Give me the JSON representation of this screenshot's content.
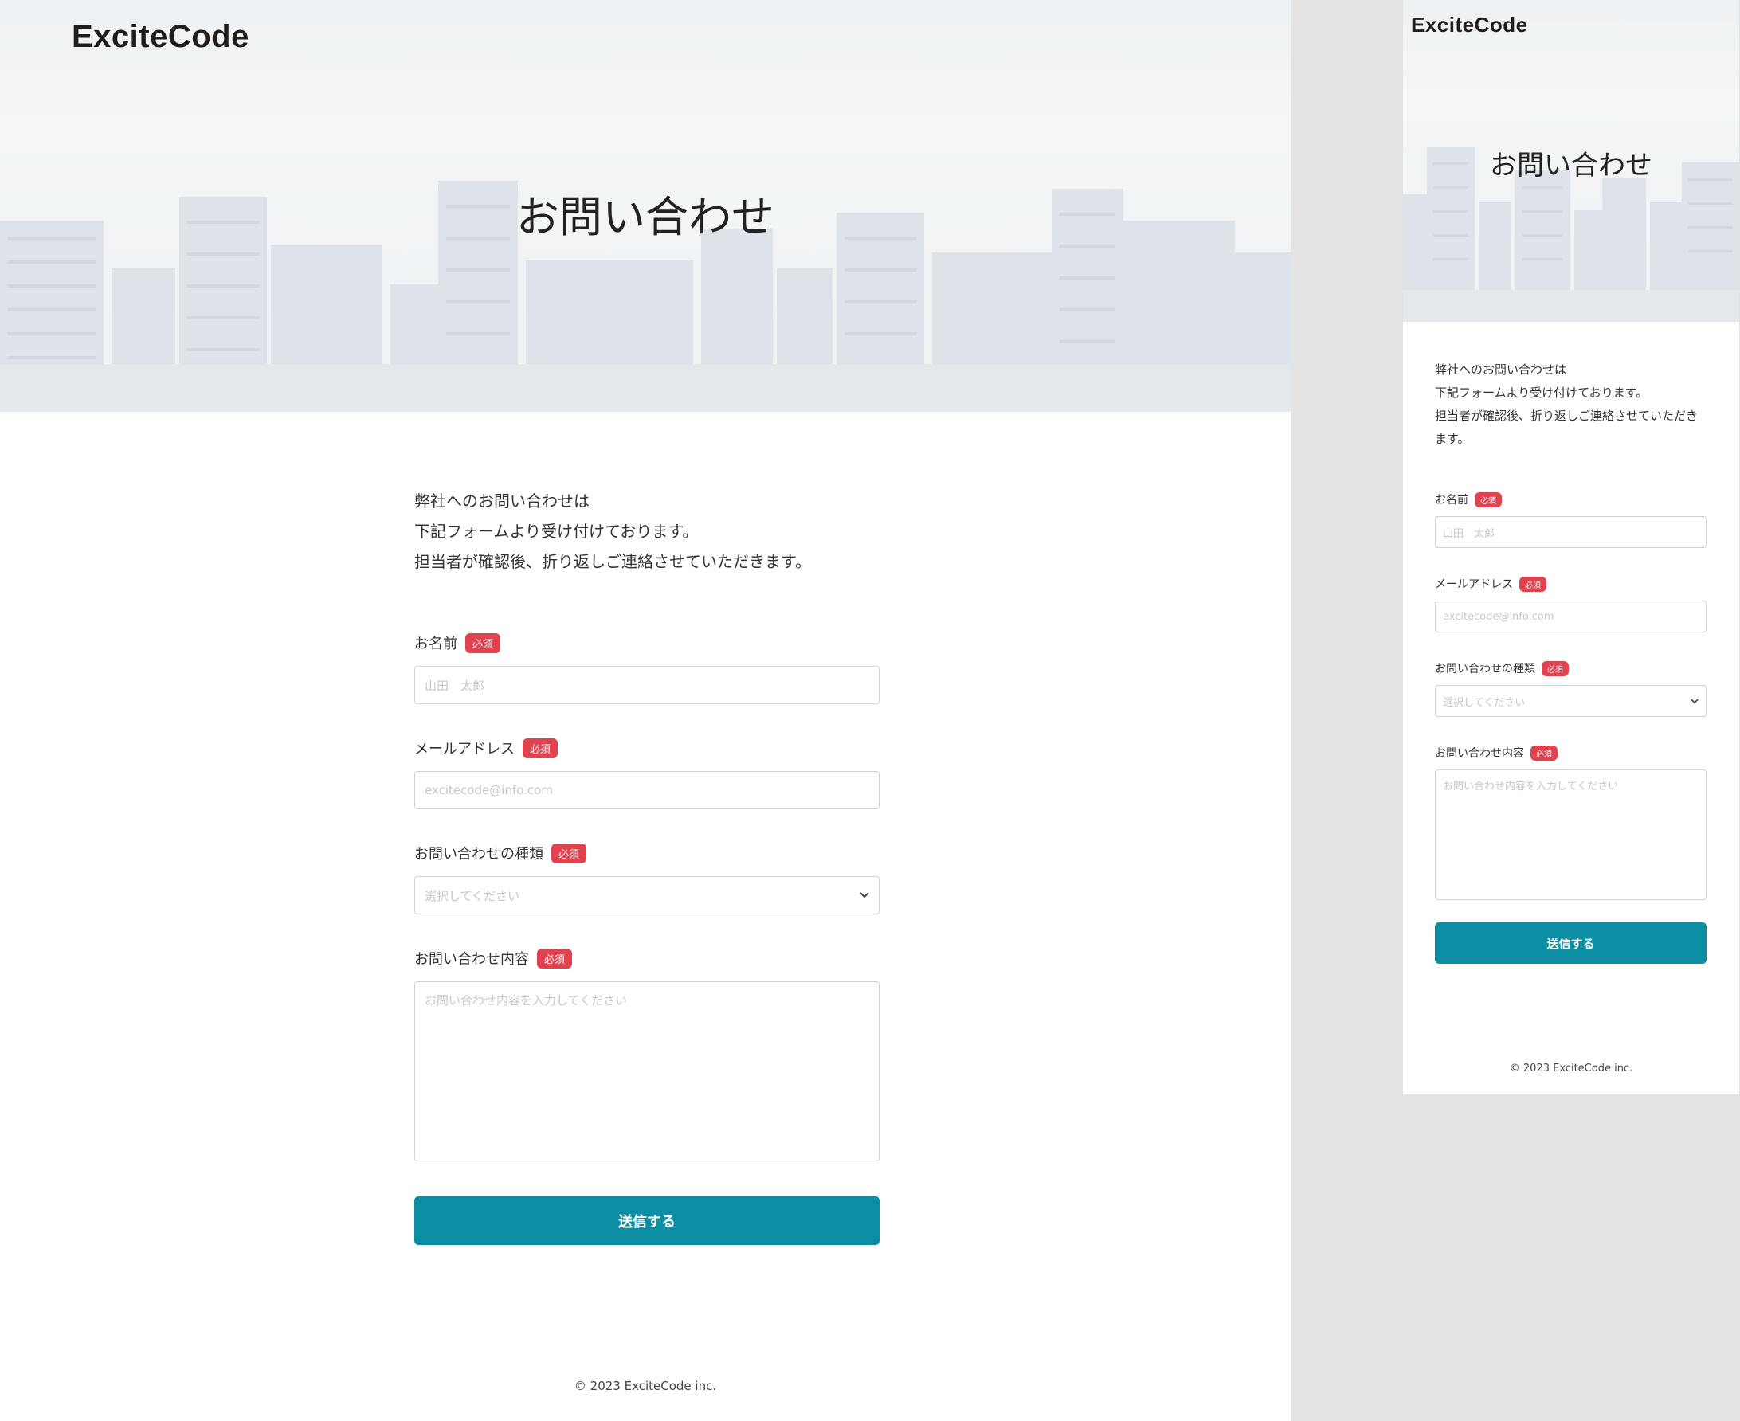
{
  "brand": "ExciteCode",
  "page_title": "お問い合わせ",
  "intro": {
    "line1": "弊社へのお問い合わせは",
    "line2": "下記フォームより受け付けております。",
    "line3": "担当者が確認後、折り返しご連絡させていただきます。",
    "line3_mobile": "担当者が確認後、折り返しご連絡させていただきます。"
  },
  "form": {
    "required_badge": "必須",
    "name": {
      "label": "お名前",
      "placeholder": "山田　太郎"
    },
    "email": {
      "label": "メールアドレス",
      "placeholder": "excitecode@info.com"
    },
    "type": {
      "label": "お問い合わせの種類",
      "placeholder": "選択してください"
    },
    "message": {
      "label": "お問い合わせ内容",
      "placeholder": "お問い合わせ内容を入力してください"
    },
    "submit_label": "送信する"
  },
  "footer": {
    "copyright": "© 2023 ExciteCode inc."
  },
  "icons": {
    "select_arrow": "chevron-down-icon"
  },
  "colors": {
    "accent": "#0b8ea3",
    "badge": "#e0424f"
  }
}
